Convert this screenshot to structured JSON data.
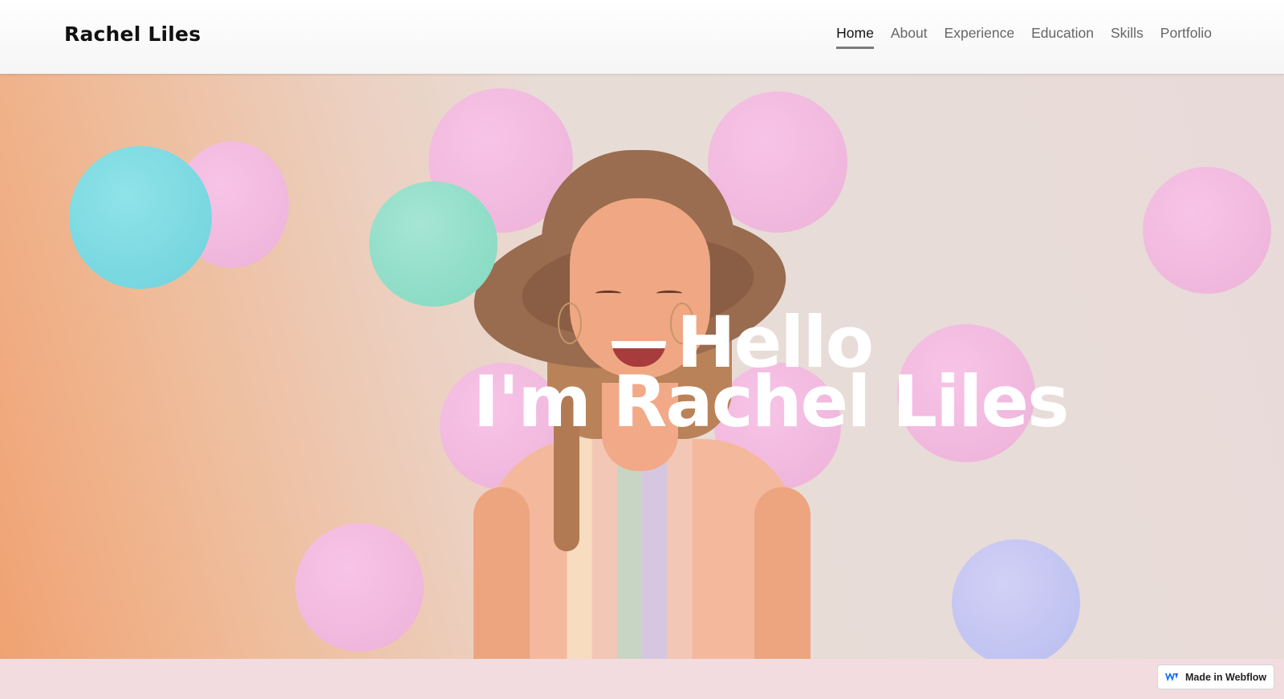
{
  "header": {
    "brand": "Rachel Liles",
    "nav": [
      {
        "label": "Home",
        "active": true
      },
      {
        "label": "About",
        "active": false
      },
      {
        "label": "Experience",
        "active": false
      },
      {
        "label": "Education",
        "active": false
      },
      {
        "label": "Skills",
        "active": false
      },
      {
        "label": "Portfolio",
        "active": false
      }
    ]
  },
  "hero": {
    "line1": "Hello",
    "line2": "I'm Rachel Liles"
  },
  "badge": {
    "icon": "webflow-logo-icon",
    "label": "Made in Webflow"
  },
  "colors": {
    "accent_underline": "#7b7b7b",
    "hero_text": "#ffffff",
    "dot_pink": "#f0b7dd",
    "dot_cyan": "#78d7e0",
    "dot_mint": "#8ddcc6",
    "dot_lavender": "#c0c3f1",
    "webflow_blue": "#146ef5"
  }
}
